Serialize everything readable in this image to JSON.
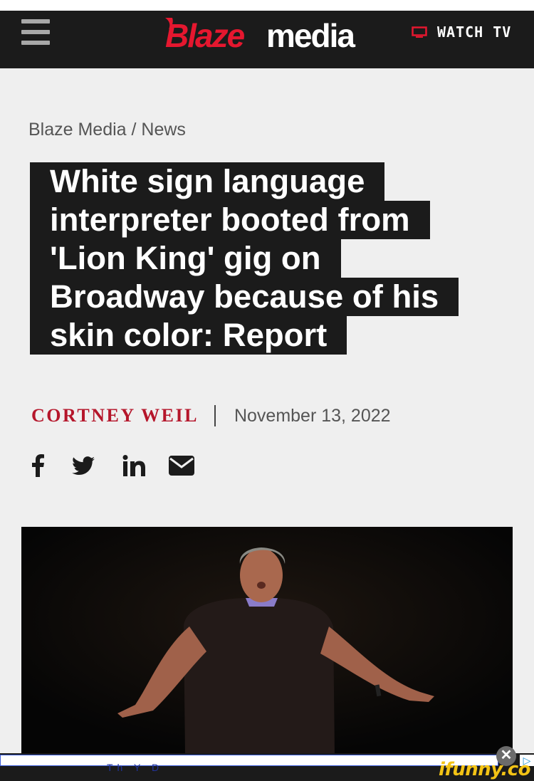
{
  "header": {
    "logo_text_1": "Blaze",
    "logo_text_2": "media",
    "watch_label": "WATCH TV",
    "menu_icon": "hamburger-menu-icon",
    "tv_icon": "tv-icon"
  },
  "breadcrumb": {
    "home": "Blaze Media",
    "separator": " / ",
    "section": "News"
  },
  "article": {
    "headline_lines": [
      "White sign language",
      "interpreter booted from",
      "'Lion King' gig on",
      "Broadway because of his",
      "skin color: Report"
    ],
    "author": "CORTNEY WEIL",
    "date": "November 13, 2022"
  },
  "social": {
    "icons": [
      "facebook-icon",
      "twitter-icon",
      "linkedin-icon",
      "email-icon"
    ]
  },
  "ad": {
    "close_label": "✕",
    "choices_label": "▷",
    "partial_text": "Th   Y       D"
  },
  "watermark": {
    "text": "ifunny.co"
  },
  "colors": {
    "header_bg": "#1b1b1b",
    "brand_red": "#e5172f",
    "author_red": "#b5162b",
    "page_bg": "#efefef"
  }
}
